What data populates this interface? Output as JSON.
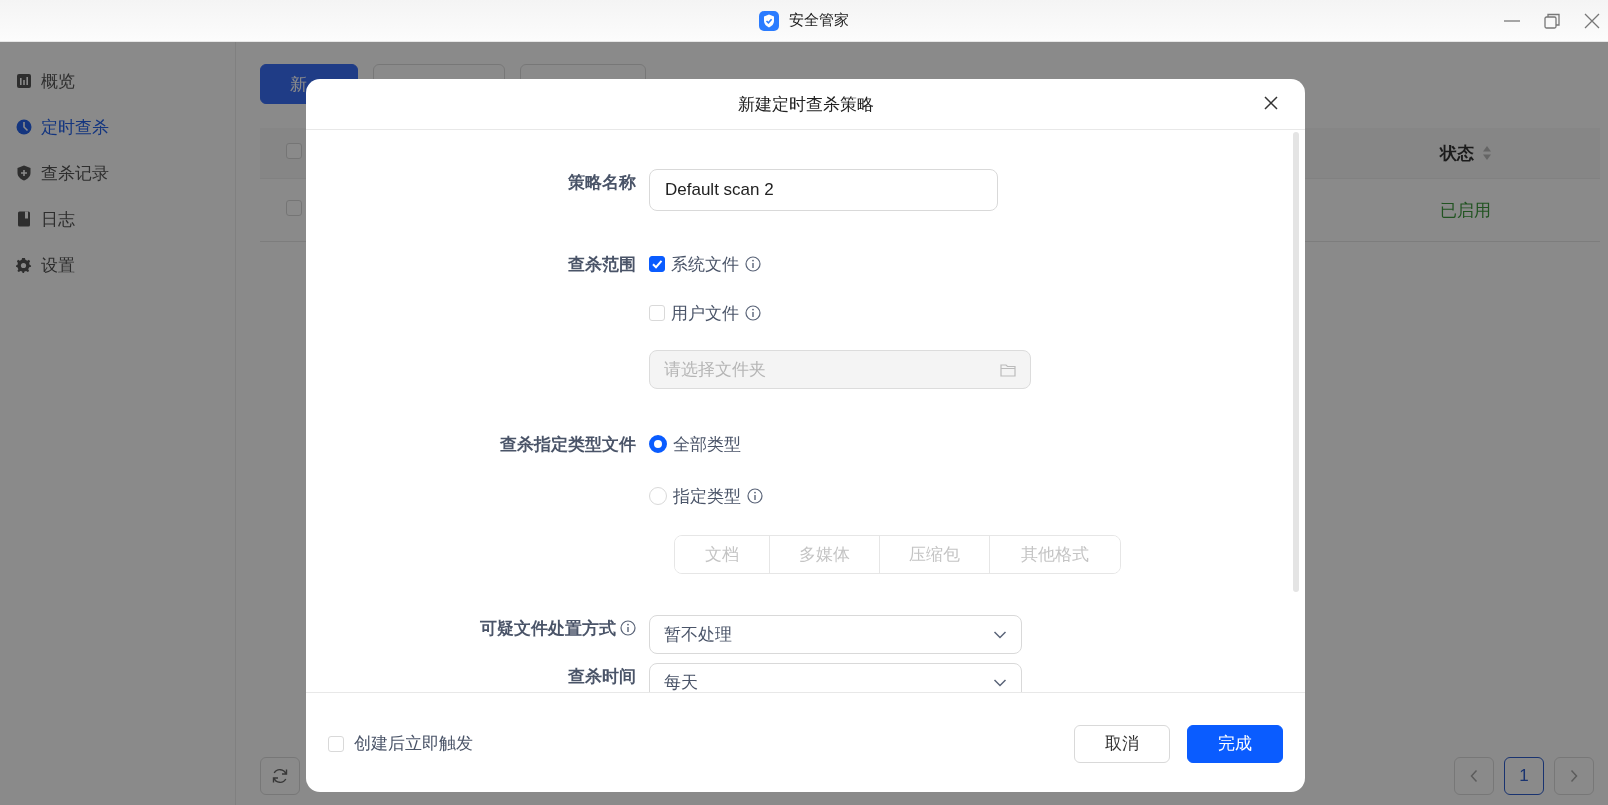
{
  "window": {
    "title": "安全管家"
  },
  "sidebar": {
    "items": [
      {
        "label": "概览",
        "selected": false
      },
      {
        "label": "定时查杀",
        "selected": true
      },
      {
        "label": "查杀记录",
        "selected": false
      },
      {
        "label": "日志",
        "selected": false
      },
      {
        "label": "设置",
        "selected": false
      }
    ]
  },
  "toolbar": {
    "new_button": "新"
  },
  "table": {
    "header_checked": false,
    "columns": [
      "状态"
    ],
    "rows": [
      {
        "checked": false,
        "status": "已启用"
      }
    ]
  },
  "pagination": {
    "pages": [
      {
        "label": "1",
        "selected": true
      }
    ]
  },
  "dialog": {
    "title": "新建定时查杀策略",
    "fields": [
      {
        "kind": "text",
        "label": "策略名称",
        "value": "Default scan 2"
      },
      {
        "kind": "checks",
        "label": "查杀范围",
        "options": [
          {
            "label": "系统文件",
            "checked": true,
            "info": true
          },
          {
            "label": "用户文件",
            "checked": false,
            "info": true
          }
        ],
        "folder": {
          "placeholder": "请选择文件夹",
          "disabled": true
        }
      },
      {
        "kind": "radios",
        "label": "查杀指定类型文件",
        "options": [
          {
            "label": "全部类型",
            "selected": true
          },
          {
            "label": "指定类型",
            "selected": false,
            "info": true
          }
        ],
        "types": [
          {
            "label": "文档",
            "disabled": true
          },
          {
            "label": "多媒体",
            "disabled": true
          },
          {
            "label": "压缩包",
            "disabled": true
          },
          {
            "label": "其他格式",
            "disabled": true
          }
        ]
      },
      {
        "kind": "select",
        "label": "可疑文件处置方式",
        "info": true,
        "value": "暂不处理"
      },
      {
        "kind": "select",
        "label": "查杀时间",
        "value": "每天"
      }
    ],
    "trigger": {
      "label": "创建后立即触发",
      "checked": false
    },
    "buttons": [
      {
        "label": "取消",
        "primary": false
      },
      {
        "label": "完成",
        "primary": true
      }
    ]
  }
}
